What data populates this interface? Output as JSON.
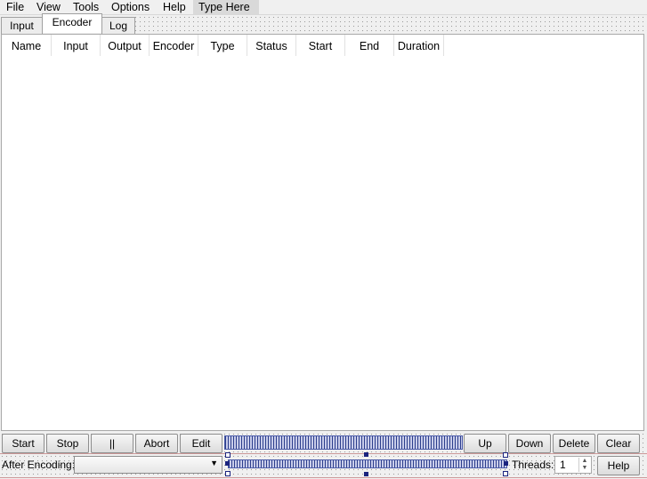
{
  "menu": [
    "File",
    "View",
    "Tools",
    "Options",
    "Help",
    "Type Here"
  ],
  "tabs": [
    "Input",
    "Encoder",
    "Log"
  ],
  "active_tab": "Encoder",
  "columns": [
    "Name",
    "Input",
    "Output",
    "Encoder",
    "Type",
    "Status",
    "Start",
    "End",
    "Duration"
  ],
  "buttons": {
    "start": "Start",
    "stop": "Stop",
    "pause": "||",
    "abort": "Abort",
    "edit": "Edit",
    "up": "Up",
    "down": "Down",
    "delete": "Delete",
    "clear": "Clear",
    "help": "Help"
  },
  "after_encoding": {
    "label": "After Encoding:",
    "value": ""
  },
  "threads": {
    "label": "Threads:",
    "value": "1"
  }
}
